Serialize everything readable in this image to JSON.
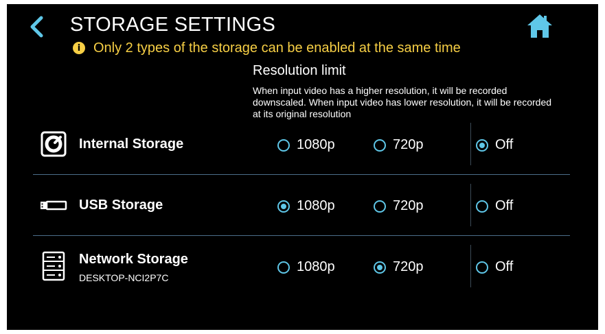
{
  "header": {
    "title": "STORAGE SETTINGS",
    "back_icon": "chevron-left-icon",
    "home_icon": "home-icon",
    "accent_color": "#5fc7e8"
  },
  "notice": {
    "icon": "info-icon",
    "icon_glyph": "i",
    "text": "Only 2 types of the storage can be enabled at the same time",
    "color": "#f7cf45"
  },
  "resolution": {
    "title": "Resolution limit",
    "description": "When input video has a higher resolution, it will be recorded downscaled. When input video has lower resolution, it will be recorded at its original resolution"
  },
  "storages": [
    {
      "name": "Internal Storage",
      "icon": "disk-icon",
      "options": [
        {
          "label": "1080p",
          "selected": false
        },
        {
          "label": "720p",
          "selected": false
        },
        {
          "label": "Off",
          "selected": true
        }
      ]
    },
    {
      "name": "USB Storage",
      "icon": "usb-drive-icon",
      "options": [
        {
          "label": "1080p",
          "selected": true
        },
        {
          "label": "720p",
          "selected": false
        },
        {
          "label": "Off",
          "selected": false
        }
      ]
    },
    {
      "name": "Network Storage",
      "subtitle": "DESKTOP-NCI2P7C",
      "icon": "server-icon",
      "options": [
        {
          "label": "1080p",
          "selected": false
        },
        {
          "label": "720p",
          "selected": true
        },
        {
          "label": "Off",
          "selected": false
        }
      ]
    }
  ]
}
